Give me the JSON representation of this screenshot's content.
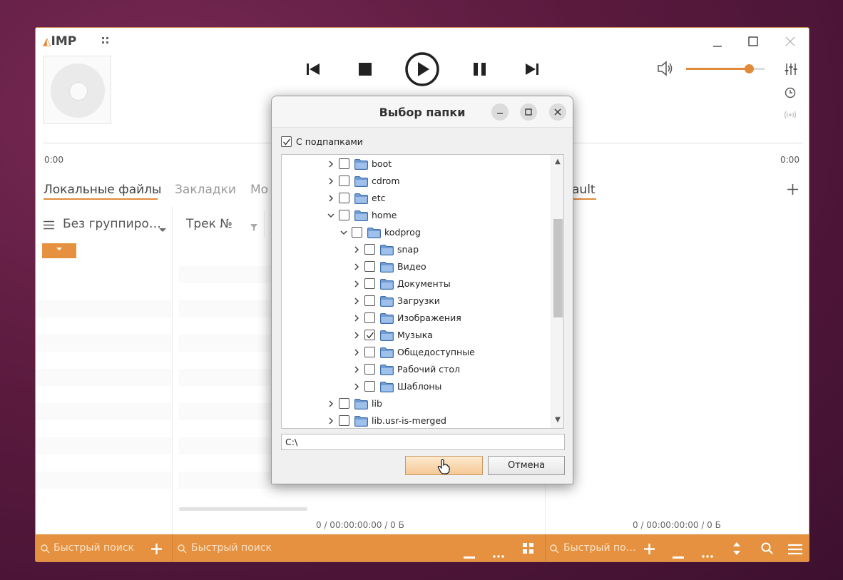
{
  "app": {
    "logo": "IMP",
    "time_elapsed": "0:00",
    "time_total": "0:00",
    "tabs": [
      {
        "label": "Локальные файлы",
        "active": true
      },
      {
        "label": "Закладки",
        "active": false
      },
      {
        "label": "Мо",
        "active": false
      },
      {
        "label": "ault",
        "active": true
      }
    ],
    "grouping_label": "Без группиро…",
    "track_column": "Трек №",
    "playlist_summary_left": "0 / 00:00:00:00 / 0 Б",
    "playlist_summary_right": "0 / 00:00:00:00 / 0 Б",
    "quick_search_1": "Быстрый поиск",
    "quick_search_2": "Быстрый поиск",
    "quick_search_3": "Быстрый по…",
    "volume_percent": 80,
    "accent_color": "#e18b3a"
  },
  "dialog": {
    "title": "Выбор папки",
    "subfolders_label": "С подпапками",
    "subfolders_checked": true,
    "path_value": "C:\\",
    "ok_label": "",
    "cancel_label": "Отмена",
    "tree": [
      {
        "name": "boot",
        "level": 0,
        "expanded": false,
        "checked": false
      },
      {
        "name": "cdrom",
        "level": 0,
        "expanded": false,
        "checked": false
      },
      {
        "name": "etc",
        "level": 0,
        "expanded": false,
        "checked": false
      },
      {
        "name": "home",
        "level": 0,
        "expanded": true,
        "checked": false
      },
      {
        "name": "kodprog",
        "level": 1,
        "expanded": true,
        "checked": false
      },
      {
        "name": "snap",
        "level": 2,
        "expanded": false,
        "checked": false
      },
      {
        "name": "Видео",
        "level": 2,
        "expanded": false,
        "checked": false
      },
      {
        "name": "Документы",
        "level": 2,
        "expanded": false,
        "checked": false
      },
      {
        "name": "Загрузки",
        "level": 2,
        "expanded": false,
        "checked": false
      },
      {
        "name": "Изображения",
        "level": 2,
        "expanded": false,
        "checked": false
      },
      {
        "name": "Музыка",
        "level": 2,
        "expanded": false,
        "checked": true
      },
      {
        "name": "Общедоступные",
        "level": 2,
        "expanded": false,
        "checked": false
      },
      {
        "name": "Рабочий стол",
        "level": 2,
        "expanded": false,
        "checked": false
      },
      {
        "name": "Шаблоны",
        "level": 2,
        "expanded": false,
        "checked": false
      },
      {
        "name": "lib",
        "level": 0,
        "expanded": false,
        "checked": false
      },
      {
        "name": "lib.usr-is-merged",
        "level": 0,
        "expanded": false,
        "checked": false
      }
    ]
  }
}
